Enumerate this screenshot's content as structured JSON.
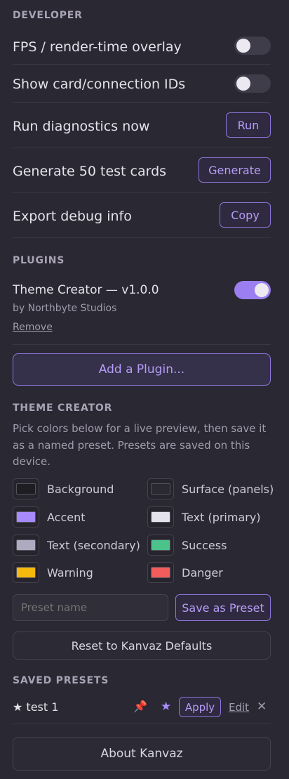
{
  "developer": {
    "title": "DEVELOPER",
    "fps_label": "FPS / render-time overlay",
    "fps_on": false,
    "ids_label": "Show card/connection IDs",
    "ids_on": false,
    "diagnostics_label": "Run diagnostics now",
    "diagnostics_button": "Run",
    "generate_label": "Generate 50 test cards",
    "generate_button": "Generate",
    "export_label": "Export debug info",
    "export_button": "Copy"
  },
  "plugins": {
    "title": "PLUGINS",
    "items": [
      {
        "name": "Theme Creator — v1.0.0",
        "author": "by Northbyte Studios",
        "remove": "Remove",
        "enabled": true
      }
    ],
    "add_button": "Add a Plugin..."
  },
  "theme_creator": {
    "title": "THEME CREATOR",
    "description": "Pick colors below for a live preview, then save it as a named preset. Presets are saved on this device.",
    "swatches": [
      {
        "label": "Background",
        "color": "#1e1d22"
      },
      {
        "label": "Surface (panels)",
        "color": "#2a2833"
      },
      {
        "label": "Accent",
        "color": "#a78bfa"
      },
      {
        "label": "Text (primary)",
        "color": "#e4e2ec"
      },
      {
        "label": "Text (secondary)",
        "color": "#aeaac0"
      },
      {
        "label": "Success",
        "color": "#4cc38a"
      },
      {
        "label": "Warning",
        "color": "#f6b90d"
      },
      {
        "label": "Danger",
        "color": "#f25c5c"
      }
    ],
    "preset_placeholder": "Preset name",
    "save_button": "Save as Preset",
    "reset_button": "Reset to Kanvaz Defaults"
  },
  "saved_presets": {
    "title": "SAVED PRESETS",
    "items": [
      {
        "name": "★ test 1",
        "pin_icon": "📌",
        "star_icon": "★",
        "apply": "Apply",
        "edit": "Edit",
        "delete_icon": "✕"
      }
    ]
  },
  "about_button": "About Kanvaz",
  "colors": {
    "accent": "#9b7ff0",
    "background": "#2a2833"
  }
}
